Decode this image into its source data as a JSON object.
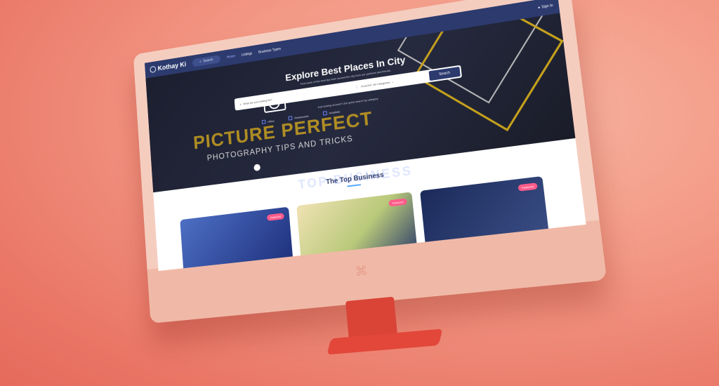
{
  "nav": {
    "brand": "Kothay Ki",
    "search_label": "Search",
    "links": [
      "Home",
      "Listings",
      "Business Types"
    ],
    "signin": "Sign In"
  },
  "hero": {
    "title": "Explore Best Places In City",
    "subtitle": "Find some of the best tips from around the city from our partners and friends.",
    "search_placeholder": "What are you looking for?",
    "places_label": "PLACES",
    "category_placeholder": "All Categories",
    "search_button": "Search",
    "categories_caption": "Just looking around? Use quick search by category",
    "categories": [
      "Office",
      "Restaurants",
      "Hospitals"
    ]
  },
  "banner": {
    "big": "PICTURE PERFECT",
    "small": "PHOTOGRAPHY TIPS AND TRICKS"
  },
  "sections": {
    "top_business_title": "The Top Business",
    "ghost_title": "TOP BUSINESS"
  },
  "cards": [
    {
      "badge": "Featured"
    },
    {
      "badge": "Featured"
    },
    {
      "badge": "Featured"
    }
  ],
  "colors": {
    "background": "#f39a86",
    "navbar": "#2c3a6e",
    "accent_yellow": "#c7a21c",
    "badge": "#ff5b8a",
    "stand": "#d94437"
  }
}
